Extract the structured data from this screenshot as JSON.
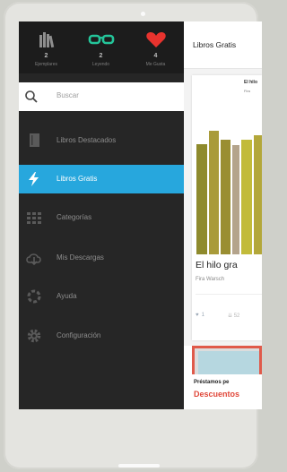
{
  "drawer": {
    "stats": [
      {
        "icon": "books-icon",
        "count": "2",
        "label": "Ejemplares"
      },
      {
        "icon": "glasses-icon",
        "count": "2",
        "label": "Leyendo"
      },
      {
        "icon": "heart-icon",
        "count": "4",
        "label": "Me Gusta"
      }
    ],
    "search": {
      "icon": "search-icon",
      "label": "Buscar"
    },
    "menu": [
      {
        "icon": "book-icon",
        "label": "Libros Destacados",
        "active": false
      },
      {
        "icon": "lightning-icon",
        "label": "Libros Gratis",
        "active": true
      },
      {
        "icon": "grid-icon",
        "label": "Categorías",
        "active": false
      },
      {
        "icon": "download-icon",
        "label": "Mis Descargas",
        "active": false
      },
      {
        "icon": "help-icon",
        "label": "Ayuda",
        "active": false
      },
      {
        "icon": "gear-icon",
        "label": "Configuración",
        "active": false
      }
    ]
  },
  "content": {
    "header_title": "Libros Gratis",
    "book": {
      "cover_title": "El hilo",
      "cover_author": "Fira",
      "title": "El hilo gra",
      "author": "Fira Warsch",
      "likes": "1",
      "downloads": "52"
    },
    "banner": {
      "line1": "Préstamos pe",
      "line2": "Descuentos"
    }
  },
  "colors": {
    "accent": "#27a7dd",
    "drawer_bg": "#262626",
    "glasses": "#24c59a",
    "heart": "#e8332e",
    "banner_red": "#e0483a"
  }
}
